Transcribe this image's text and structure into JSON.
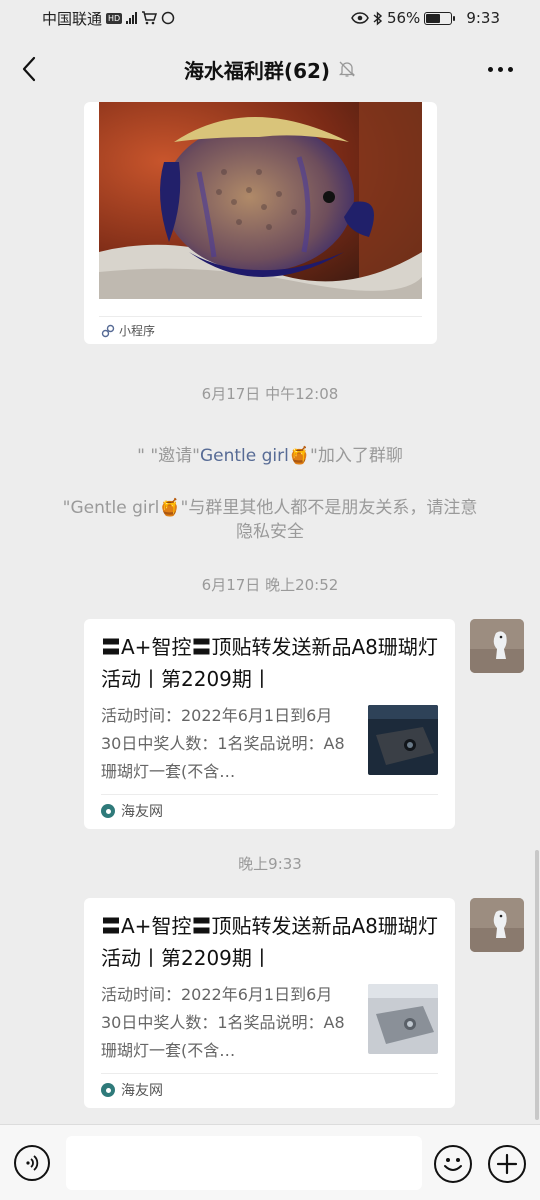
{
  "status_bar": {
    "carrier": "中国联通",
    "hd_badge": "HD",
    "network": "4G",
    "battery_percent": "56%",
    "time": "9:33"
  },
  "header": {
    "title": "海水福利群(62)",
    "back_icon": "chevron-left-icon",
    "mute_icon": "bell-off-icon",
    "more_icon": "more-dots-icon"
  },
  "messages": {
    "mini_program": {
      "label": "小程序"
    },
    "time_1": "6月17日 中午12:08",
    "invite": {
      "prefix": "\"    \"邀请\"",
      "name": "Gentle girl",
      "suffix": "\"加入了群聊"
    },
    "privacy": {
      "line1": "\"Gentle girl",
      "line1_rest": "\"与群里其他人都不是朋友关系，请注意",
      "line2": "隐私安全"
    },
    "time_2": "6月17日 晚上20:52",
    "card_1": {
      "title": "〓A+智控〓顶贴转发送新品A8珊瑚灯活动丨第2209期丨",
      "desc": "活动时间：2022年6月1日到6月30日中奖人数：1名奖品说明：A8珊瑚灯一套(不含…",
      "source": "海友网"
    },
    "time_3": "晚上9:33",
    "card_2": {
      "title": "〓A+智控〓顶贴转发送新品A8珊瑚灯活动丨第2209期丨",
      "desc": "活动时间：2022年6月1日到6月30日中奖人数：1名奖品说明：A8珊瑚灯一套(不含…",
      "source": "海友网"
    }
  },
  "input_bar": {
    "placeholder": "",
    "voice_icon": "voice-icon",
    "emoji_icon": "emoji-icon",
    "plus_icon": "plus-icon"
  }
}
